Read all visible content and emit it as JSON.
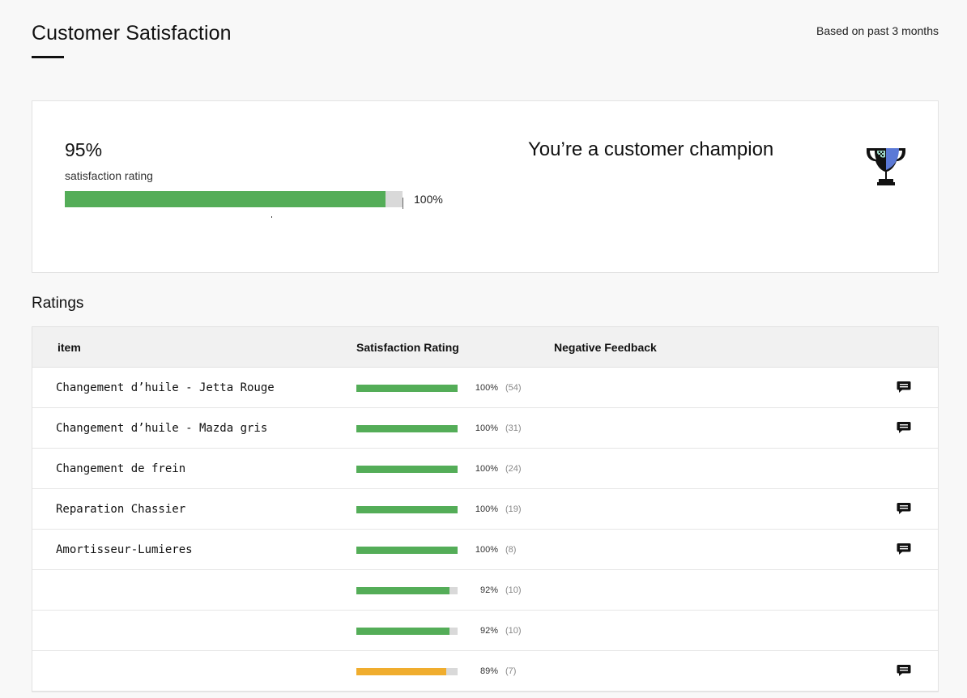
{
  "header": {
    "title": "Customer Satisfaction",
    "period": "Based on past 3 months"
  },
  "summary": {
    "percent_label": "95%",
    "percent": 95,
    "label": "satisfaction rating",
    "max_label": "100%",
    "message": "You’re a customer champion",
    "badge_icon": "trophy-icon",
    "colors": {
      "bar_fill": "#54ad58",
      "bar_track": "#d9d9d9"
    }
  },
  "ratings": {
    "title": "Ratings",
    "columns": [
      "item",
      "Satisfaction Rating",
      "Negative Feedback"
    ],
    "rows": [
      {
        "name": "Changement d’huile - Jetta Rouge",
        "percent": 100,
        "percent_label": "100%",
        "count": "(54)",
        "has_feedback": true,
        "color": "#54ad58"
      },
      {
        "name": "Changement d’huile - Mazda gris",
        "percent": 100,
        "percent_label": "100%",
        "count": "(31)",
        "has_feedback": true,
        "color": "#54ad58"
      },
      {
        "name": "Changement de frein",
        "percent": 100,
        "percent_label": "100%",
        "count": "(24)",
        "has_feedback": false,
        "color": "#54ad58"
      },
      {
        "name": "Reparation Chassier",
        "percent": 100,
        "percent_label": "100%",
        "count": "(19)",
        "has_feedback": true,
        "color": "#54ad58"
      },
      {
        "name": "Amortisseur-Lumieres",
        "percent": 100,
        "percent_label": "100%",
        "count": "(8)",
        "has_feedback": true,
        "color": "#54ad58"
      },
      {
        "name": "",
        "percent": 92,
        "percent_label": "92%",
        "count": "(10)",
        "has_feedback": false,
        "color": "#54ad58"
      },
      {
        "name": "",
        "percent": 92,
        "percent_label": "92%",
        "count": "(10)",
        "has_feedback": false,
        "color": "#54ad58"
      },
      {
        "name": "",
        "percent": 89,
        "percent_label": "89%",
        "count": "(7)",
        "has_feedback": true,
        "color": "#f0ad2e"
      }
    ],
    "feedback_icon": "chat-bubble-icon"
  }
}
